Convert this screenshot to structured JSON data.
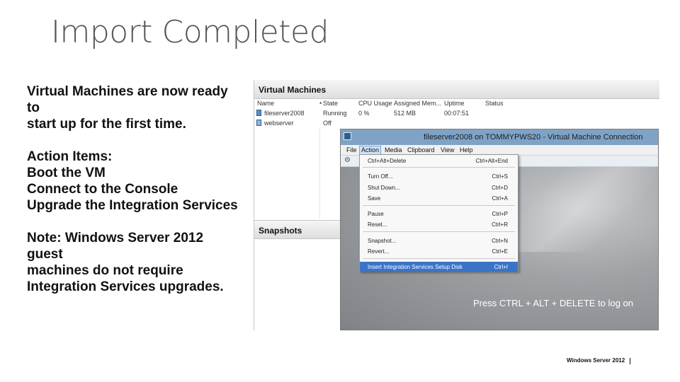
{
  "slide": {
    "title": "Import Completed",
    "footer": "Windows Server 2012"
  },
  "left_text": {
    "intro_lines": [
      "Virtual Machines are now ready to",
      "start up for the first time."
    ],
    "actions_lines": [
      "Action Items:",
      "Boot the VM",
      "Connect to the Console",
      "Upgrade the Integration Services"
    ],
    "note_lines": [
      "Note: Windows Server 2012 guest",
      "machines do not require",
      "Integration Services upgrades."
    ]
  },
  "hyperv": {
    "vm_header": "Virtual Machines",
    "columns": [
      "Name",
      "State",
      "CPU Usage",
      "Assigned Mem...",
      "Uptime",
      "Status"
    ],
    "rows": [
      {
        "name": "fileserver2008",
        "state": "Running",
        "cpu": "0 %",
        "memory": "512 MB",
        "uptime": "00:07:51",
        "status": ""
      },
      {
        "name": "webserver",
        "state": "Off",
        "cpu": "",
        "memory": "",
        "uptime": "",
        "status": ""
      }
    ],
    "snapshots_header": "Snapshots"
  },
  "vm_connection": {
    "title": "fileserver2008 on TOMMYPWS20 - Virtual Machine Connection",
    "menu": [
      "File",
      "Action",
      "Media",
      "Clipboard",
      "View",
      "Help"
    ],
    "active_menu": "Action",
    "login_prompt": "Press CTRL + ALT + DELETE to log on"
  },
  "action_menu": [
    {
      "label": "Ctrl+Alt+Delete",
      "shortcut": "Ctrl+Alt+End"
    },
    {
      "label": "Turn Off...",
      "shortcut": "Ctrl+S"
    },
    {
      "label": "Shut Down...",
      "shortcut": "Ctrl+D"
    },
    {
      "label": "Save",
      "shortcut": "Ctrl+A"
    },
    {
      "label": "Pause",
      "shortcut": "Ctrl+P"
    },
    {
      "label": "Reset...",
      "shortcut": "Ctrl+R"
    },
    {
      "label": "Snapshot...",
      "shortcut": "Ctrl+N"
    },
    {
      "label": "Revert...",
      "shortcut": "Ctrl+E"
    },
    {
      "label": "Insert Integration Services Setup Disk",
      "shortcut": "Ctrl+I"
    }
  ],
  "colors": {
    "menu_highlight": "#3b74c7",
    "title_bar": "#7fa3c7",
    "vm_screen": "#8a8d90"
  }
}
